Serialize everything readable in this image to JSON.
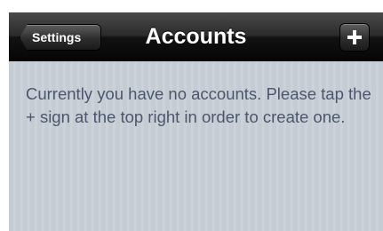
{
  "navbar": {
    "back_label": "Settings",
    "title": "Accounts",
    "add_icon": "plus-icon"
  },
  "content": {
    "message": "Currently you have no accounts. Please tap the + sign at the top right in order to create one."
  },
  "colors": {
    "navbar_bg": "#1a1a1a",
    "content_bg": "#c5ccd4",
    "message_text": "#4c566c"
  }
}
